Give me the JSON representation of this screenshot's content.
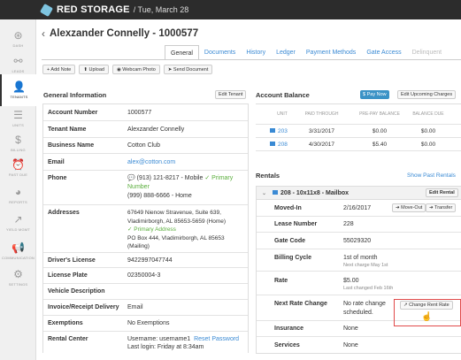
{
  "app": {
    "brand": "RED STORAGE",
    "date": "/ Tue, March 28"
  },
  "sidebar": {
    "items": [
      {
        "label": "DASH",
        "icon": "dashboard-icon",
        "glyph": "⊛"
      },
      {
        "label": "LEADS",
        "icon": "leads-icon",
        "glyph": "⚯"
      },
      {
        "label": "TENANTS",
        "icon": "tenants-icon",
        "glyph": "👤"
      },
      {
        "label": "UNITS",
        "icon": "units-icon",
        "glyph": "☰"
      },
      {
        "label": "BILLING",
        "icon": "billing-icon",
        "glyph": "$"
      },
      {
        "label": "PAST DUE",
        "icon": "alarm-clock-icon",
        "glyph": "⏰"
      },
      {
        "label": "REPORTS",
        "icon": "pie-chart-icon",
        "glyph": "◕"
      },
      {
        "label": "YIELD MGMT",
        "icon": "trend-up-icon",
        "glyph": "↗"
      },
      {
        "label": "COMMUNICATION",
        "icon": "megaphone-icon",
        "glyph": "📢"
      },
      {
        "label": "SETTINGS",
        "icon": "gear-icon",
        "glyph": "⚙"
      }
    ]
  },
  "page": {
    "title": "Alexzander Connelly - 1000577",
    "back_icon": "chevron-left-icon"
  },
  "tabs": [
    "General",
    "Documents",
    "History",
    "Ledger",
    "Payment Methods",
    "Gate Access",
    "Delinquent"
  ],
  "toolbar": {
    "add_note": "+ Add Note",
    "upload": "⬆ Upload",
    "webcam": "◉ Webcam Photo",
    "send": "➤ Send Document"
  },
  "general_info": {
    "title": "General Information",
    "edit_label": "Edit Tenant",
    "account_number": {
      "label": "Account Number",
      "value": "1000577"
    },
    "tenant_name": {
      "label": "Tenant Name",
      "value": "Alexzander Connelly"
    },
    "business_name": {
      "label": "Business Name",
      "value": "Cotton Club"
    },
    "email": {
      "label": "Email",
      "value": "alex@cotton.com"
    },
    "phone": {
      "label": "Phone",
      "line1": "(913) 121-8217 - Mobile",
      "primary": "✓ Primary",
      "line2": "Number",
      "line3": "(999) 888-6666 - Home"
    },
    "addresses": {
      "label": "Addresses",
      "line1": "67649 Nienow Stravenue, Suite 639,",
      "line2": "Vladimirborgh, AL 85653-5659 (Home)",
      "primary": "✓ Primary Address",
      "line3": "PO Box 444, Vladimirborgh, AL 85653",
      "line4": "(Mailing)"
    },
    "drivers_license": {
      "label": "Driver's License",
      "value": "9422997047744"
    },
    "license_plate": {
      "label": "License Plate",
      "value": "02350004-3"
    },
    "vehicle": {
      "label": "Vehicle Description",
      "value": ""
    },
    "invoice": {
      "label": "Invoice/Receipt Delivery",
      "value": "Email"
    },
    "exemptions": {
      "label": "Exemptions",
      "value": "No Exemptions"
    },
    "rental_center": {
      "label": "Rental Center",
      "line1": "Username: username1",
      "reset": "Reset Password",
      "line2": "Last login: Friday at 8:34am"
    }
  },
  "account_balance": {
    "title": "Account Balance",
    "pay_now": "$ Pay Now",
    "edit_charges": "Edit Upcoming Charges",
    "headers": [
      "UNIT",
      "PAID THROUGH",
      "PRE-PAY BALANCE",
      "BALANCE DUE"
    ],
    "rows": [
      {
        "unit": "203",
        "paid_through": "3/31/2017",
        "prepay": "$0.00",
        "due": "$0.00"
      },
      {
        "unit": "208",
        "paid_through": "4/30/2017",
        "prepay": "$5.40",
        "due": "$0.00"
      }
    ]
  },
  "rentals": {
    "title": "Rentals",
    "show_past": "Show Past Rentals",
    "unit_header": "208 - 10x11x8 - Mailbox",
    "edit_rental": "Edit Rental",
    "moved_in": {
      "label": "Moved-In",
      "value": "2/16/2017",
      "move_out": "➜ Move-Out",
      "transfer": "➜ Transfer"
    },
    "lease_number": {
      "label": "Lease Number",
      "value": "228"
    },
    "gate_code": {
      "label": "Gate Code",
      "value": "55029320"
    },
    "billing_cycle": {
      "label": "Billing Cycle",
      "value": "1st of month",
      "sub": "Next charge May 1st"
    },
    "rate": {
      "label": "Rate",
      "value": "$5.00",
      "sub": "Last changed Feb 16th"
    },
    "next_rate_change": {
      "label": "Next Rate Change",
      "line1": "No rate change",
      "line2": "scheduled.",
      "button": "↗ Change Rent Rate"
    },
    "insurance": {
      "label": "Insurance",
      "value": "None"
    },
    "services": {
      "label": "Services",
      "value": "None"
    }
  },
  "colors": {
    "accent": "#3a8ad4",
    "topbar": "#2c2c2c",
    "pay_now": "#3b93c6",
    "highlight": "#e04a4a",
    "primary_green": "#5aae3c"
  }
}
